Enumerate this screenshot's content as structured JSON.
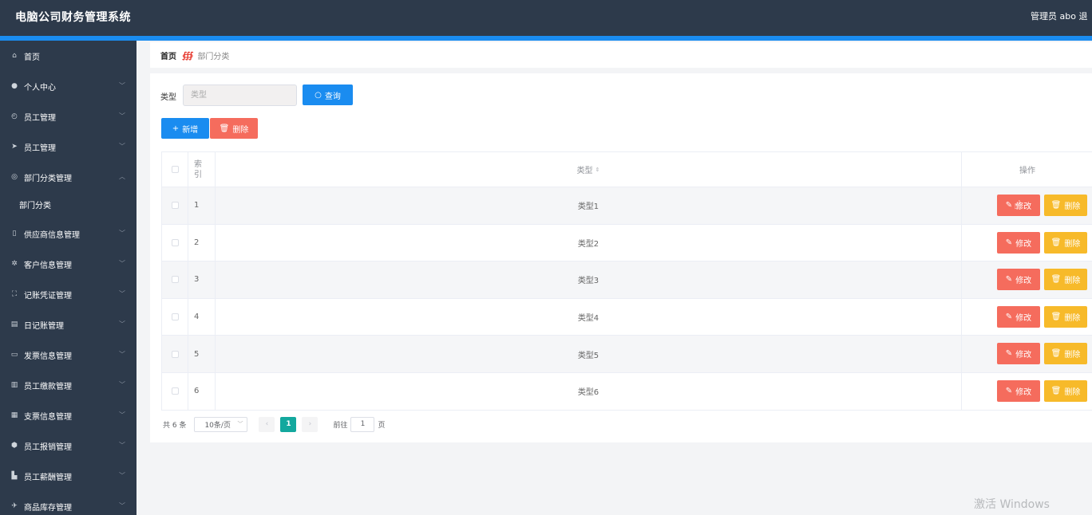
{
  "header": {
    "title": "电脑公司财务管理系统",
    "user": "管理员 abo  退"
  },
  "sidebar": {
    "items": [
      {
        "icon": "home-icon",
        "glyph": "⌂",
        "label": "首页",
        "chevron": false
      },
      {
        "icon": "user-icon",
        "glyph": "●",
        "label": "个人中心",
        "chevron": true
      },
      {
        "icon": "clock-icon",
        "glyph": "◴",
        "label": "员工管理",
        "chevron": true
      },
      {
        "icon": "send-icon",
        "glyph": "➤",
        "label": "员工管理",
        "chevron": true
      },
      {
        "icon": "dept-icon",
        "glyph": "◎",
        "label": "部门分类管理",
        "chevron": true,
        "open": true
      },
      {
        "icon": "supplier-icon",
        "glyph": "▯",
        "label": "供应商信息管理",
        "chevron": true
      },
      {
        "icon": "customer-icon",
        "glyph": "✲",
        "label": "客户信息管理",
        "chevron": true
      },
      {
        "icon": "voucher-icon",
        "glyph": "⛶",
        "label": "记账凭证管理",
        "chevron": true
      },
      {
        "icon": "journal-icon",
        "glyph": "▤",
        "label": "日记账管理",
        "chevron": true
      },
      {
        "icon": "invoice-icon",
        "glyph": "▭",
        "label": "发票信息管理",
        "chevron": true
      },
      {
        "icon": "bar-chart-icon",
        "glyph": "▥",
        "label": "员工缴款管理",
        "chevron": true
      },
      {
        "icon": "grid-icon",
        "glyph": "▦",
        "label": "支票信息管理",
        "chevron": true
      },
      {
        "icon": "badge-icon",
        "glyph": "⬢",
        "label": "员工报销管理",
        "chevron": true
      },
      {
        "icon": "thumb-icon",
        "glyph": "▙",
        "label": "员工薪酬管理",
        "chevron": true
      },
      {
        "icon": "plane-icon",
        "glyph": "✈",
        "label": "商品库存管理",
        "chevron": true
      }
    ],
    "sub_item": "部门分类"
  },
  "breadcrumb": {
    "home": "首页",
    "current": "部门分类"
  },
  "search": {
    "label": "类型",
    "placeholder": "类型",
    "button": "查询"
  },
  "actions": {
    "add": "新增",
    "delete": "删除"
  },
  "table": {
    "headers": {
      "index": "索引",
      "type": "类型",
      "ops": "操作"
    },
    "rows": [
      {
        "index": "1",
        "type": "类型1"
      },
      {
        "index": "2",
        "type": "类型2"
      },
      {
        "index": "3",
        "type": "类型3"
      },
      {
        "index": "4",
        "type": "类型4"
      },
      {
        "index": "5",
        "type": "类型5"
      },
      {
        "index": "6",
        "type": "类型6"
      }
    ],
    "edit_label": "修改",
    "delete_label": "删除"
  },
  "pagination": {
    "total": "共 6 条",
    "page_size": "10条/页",
    "current_page": "1",
    "goto_label": "前往",
    "goto_value": "1",
    "page_suffix": "页"
  },
  "watermark": "激活 Windows",
  "colors": {
    "primary": "#1a8cf0",
    "danger": "#f56c5d",
    "warning": "#f7ba2a",
    "sidebar": "#2d3a4b",
    "page_active": "#13a89e"
  }
}
